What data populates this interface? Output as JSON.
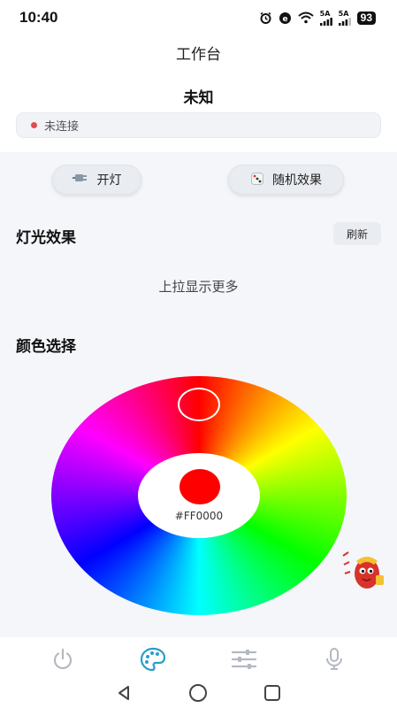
{
  "status_bar": {
    "time": "10:40",
    "signal1_label": "5A",
    "signal2_label": "5A",
    "battery": "93"
  },
  "header": {
    "title": "工作台",
    "device_name": "未知",
    "connection_status": "未连接",
    "status_color": "#e24c4c"
  },
  "quick_actions": {
    "light_label": "开灯",
    "random_label": "随机效果"
  },
  "effects": {
    "title": "灯光效果",
    "refresh_label": "刷新",
    "hint": "上拉显示更多"
  },
  "color_picker": {
    "title": "颜色选择",
    "selected_hex": "#FF0000",
    "selected_color": "#ff0000"
  },
  "nav": {
    "items": [
      "power-icon",
      "palette-icon",
      "sliders-icon",
      "microphone-icon"
    ],
    "active_index": 1,
    "active_color": "#2a9dc9",
    "inactive_color": "#b4b8c0"
  }
}
